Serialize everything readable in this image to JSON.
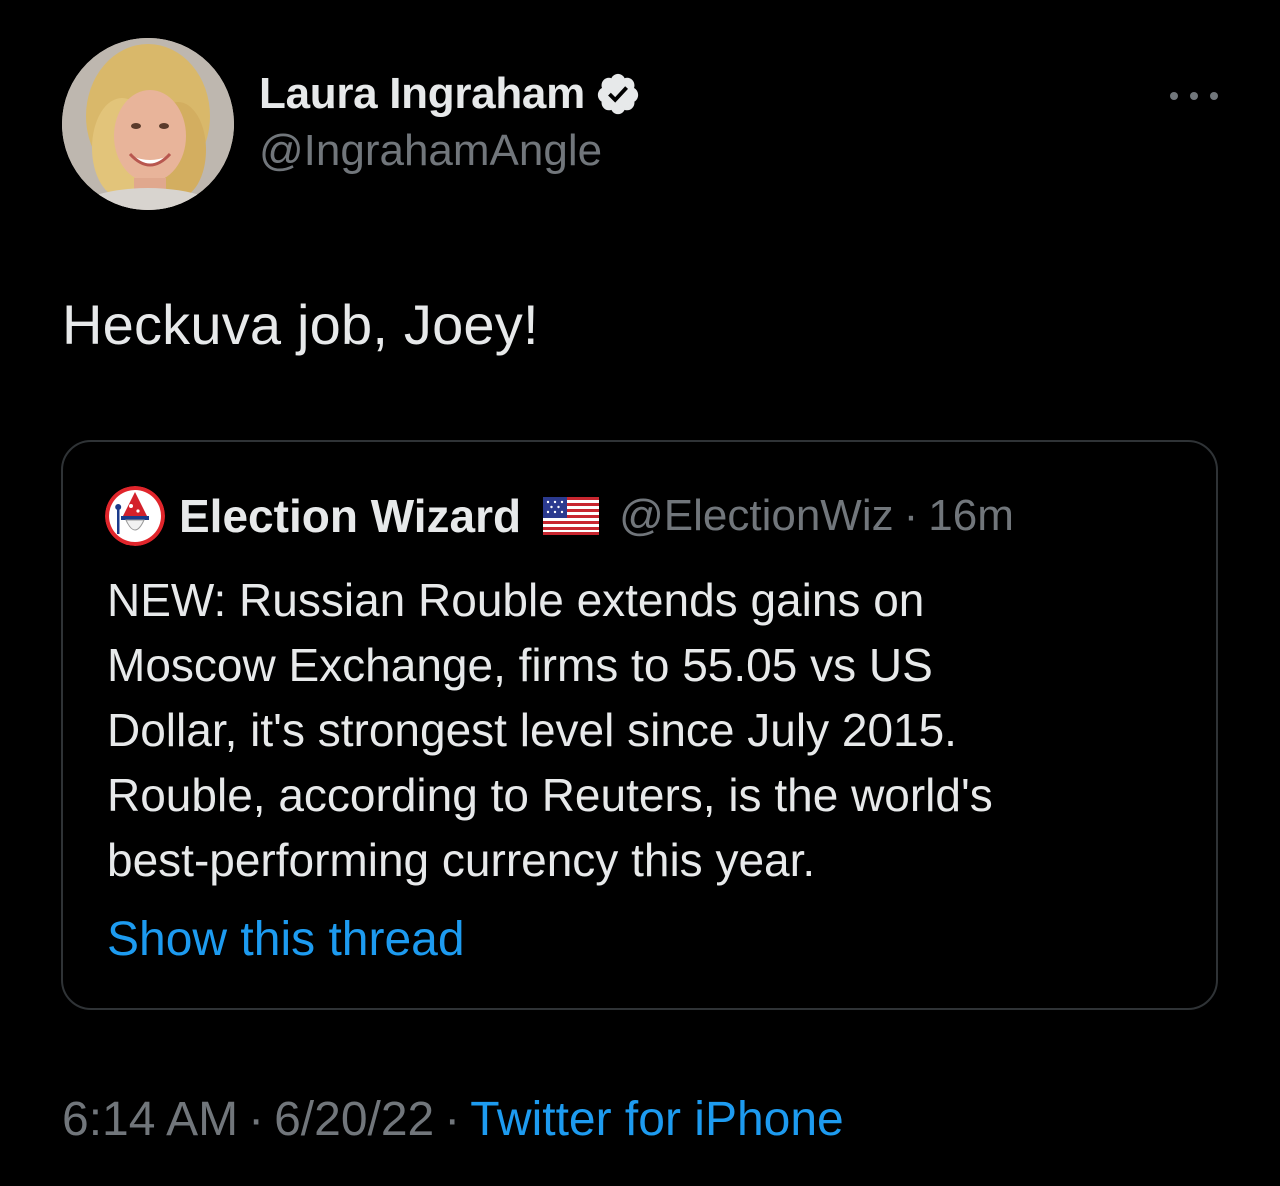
{
  "author": {
    "display_name": "Laura Ingraham",
    "handle": "@IngrahamAngle",
    "verified": true
  },
  "tweet": {
    "text": "Heckuva job, Joey!",
    "time": "6:14 AM",
    "date": "6/20/22",
    "source": "Twitter for iPhone",
    "separator": "·"
  },
  "quoted_tweet": {
    "display_name": "Election Wizard",
    "flag_icon": "us-flag-icon",
    "handle": "@ElectionWiz",
    "separator": "·",
    "time": "16m",
    "text_lines": [
      "NEW: Russian Rouble extends gains on",
      "Moscow Exchange, firms to 55.05 vs US",
      "Dollar, it's strongest level since July 2015.",
      "Rouble, according to Reuters, is the world's",
      "best-performing currency this year."
    ],
    "show_thread_label": "Show this thread"
  },
  "colors": {
    "background": "#000000",
    "primary_text": "#e7e9ea",
    "secondary_text": "#71767b",
    "link": "#1d9bf0",
    "border": "#2f3336"
  }
}
